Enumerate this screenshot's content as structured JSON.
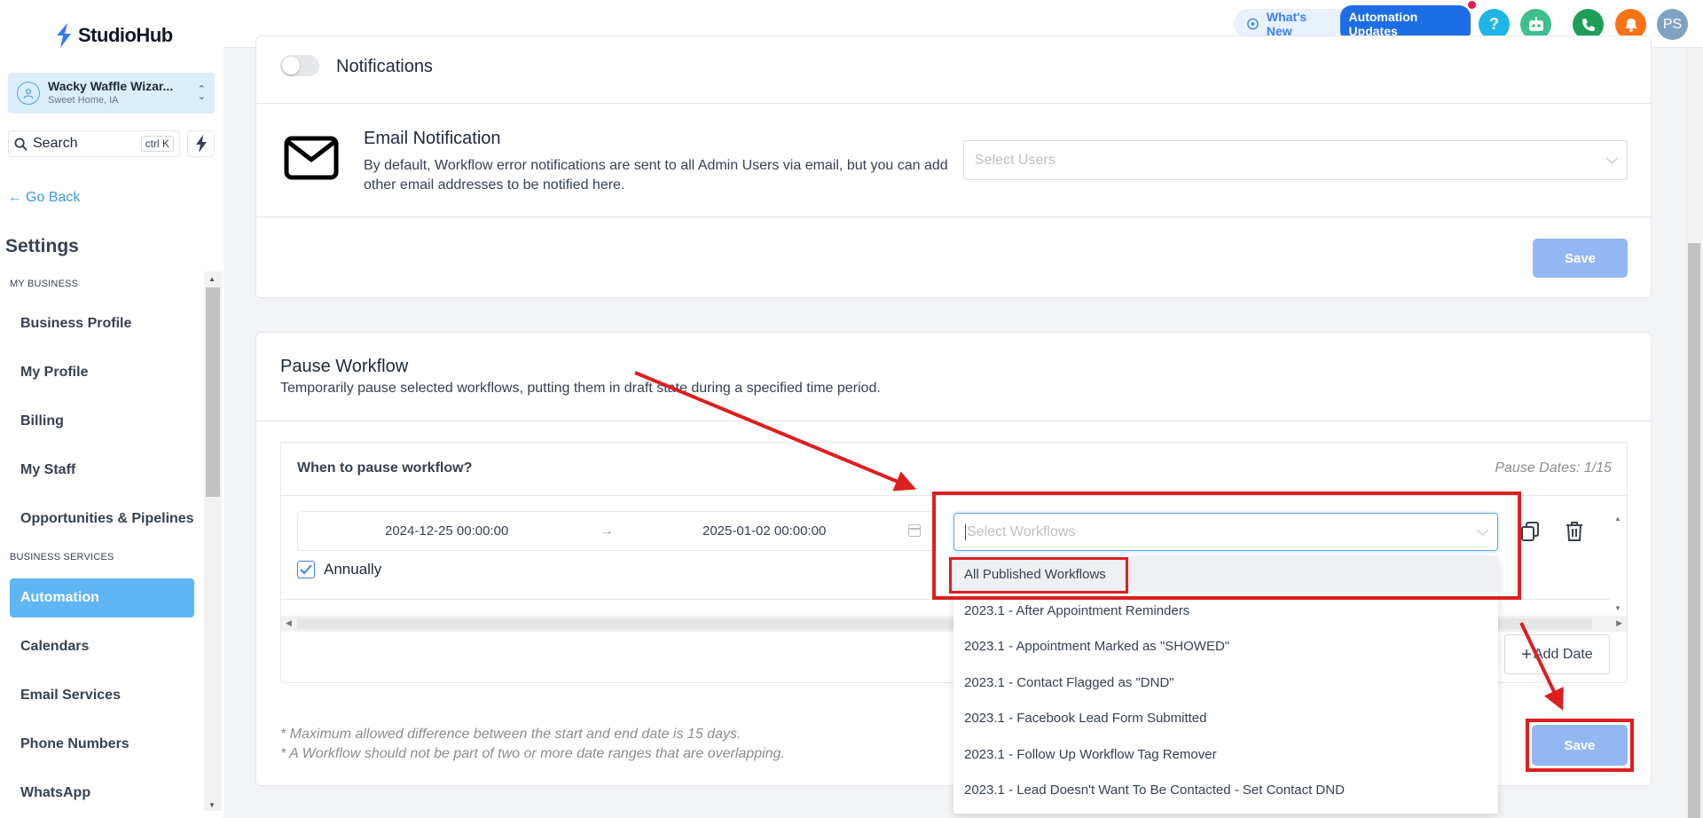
{
  "sidebar": {
    "brand": "StudioHub",
    "account": {
      "name": "Wacky Waffle Wizar...",
      "location": "Sweet Home, IA"
    },
    "search": {
      "label": "Search",
      "shortcut": "ctrl K"
    },
    "go_back": "Go Back",
    "settings_title": "Settings",
    "sections": [
      {
        "label": "MY BUSINESS"
      },
      {
        "label": "BUSINESS SERVICES"
      }
    ],
    "items": [
      {
        "label": "Business Profile"
      },
      {
        "label": "My Profile"
      },
      {
        "label": "Billing"
      },
      {
        "label": "My Staff"
      },
      {
        "label": "Opportunities & Pipelines"
      },
      {
        "label": "Automation",
        "active": true
      },
      {
        "label": "Calendars"
      },
      {
        "label": "Email Services"
      },
      {
        "label": "Phone Numbers"
      },
      {
        "label": "WhatsApp"
      }
    ]
  },
  "topbar": {
    "whats_new": "What's New",
    "automation_updates": "Automation Updates",
    "help": "?",
    "avatar": "PS"
  },
  "notifications": {
    "toggle_label": "Notifications",
    "toggle_on": false,
    "email_title": "Email Notification",
    "email_desc": "By default, Workflow error notifications are sent to all Admin Users via email, but you can add other email addresses to be notified here.",
    "select_users_placeholder": "Select Users",
    "save": "Save"
  },
  "pause_workflow": {
    "title": "Pause Workflow",
    "description": "Temporarily pause selected workflows, putting them in draft state during a specified time period.",
    "when_label": "When to pause workflow?",
    "pause_dates": "Pause Dates: 1/15",
    "start": "2024-12-25 00:00:00",
    "end": "2025-01-02 00:00:00",
    "annually_label": "Annually",
    "annually_checked": true,
    "select_workflows_placeholder": "Select Workflows",
    "add_date": "Add Date",
    "save": "Save",
    "notes": [
      "* Maximum allowed difference between the start and end date is 15 days.",
      "* A Workflow should not be part of two or more date ranges that are overlapping."
    ],
    "dropdown_options": [
      "All Published Workflows",
      "2023.1 - After Appointment Reminders",
      "2023.1 - Appointment Marked as \"SHOWED\"",
      "2023.1 - Contact Flagged as \"DND\"",
      "2023.1 - Facebook Lead Form Submitted",
      "2023.1 - Follow Up Workflow Tag Remover",
      "2023.1 - Lead Doesn't Want To Be Contacted - Set Contact DND"
    ]
  },
  "colors": {
    "accent": "#60b6f4",
    "primary": "#1d6ee6",
    "save_button": "#93b7f3",
    "annotation_red": "#dc1f1f"
  }
}
